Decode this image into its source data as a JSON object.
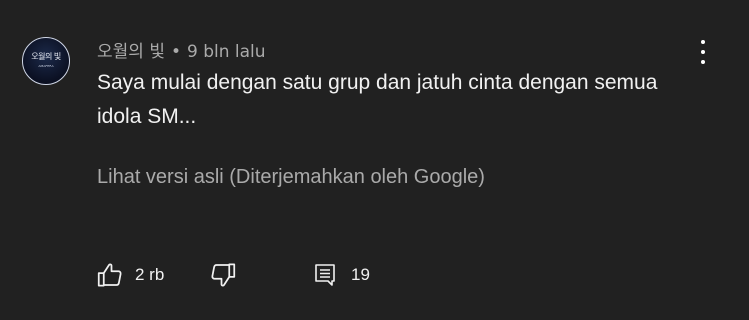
{
  "comment": {
    "avatar_line1": "오월의 빛",
    "avatar_line2": "ᴬᴹᴬᴾᴱᴿᴬ",
    "author": "오월의 빛",
    "separator": "•",
    "time": "9 bln lalu",
    "text": "Saya mulai dengan satu grup dan jatuh cinta dengan semua idola SM...",
    "translate_label": "Lihat versi asli (Diterjemahkan oleh Google)",
    "like_count": "2 rb",
    "reply_count": "19"
  },
  "icons": {
    "like": "thumbs-up-icon",
    "dislike": "thumbs-down-icon",
    "reply": "comment-reply-icon",
    "menu": "more-vertical-icon"
  },
  "colors": {
    "background": "#212121",
    "primary_text": "#f1f1f1",
    "secondary_text": "#aaaaaa"
  }
}
